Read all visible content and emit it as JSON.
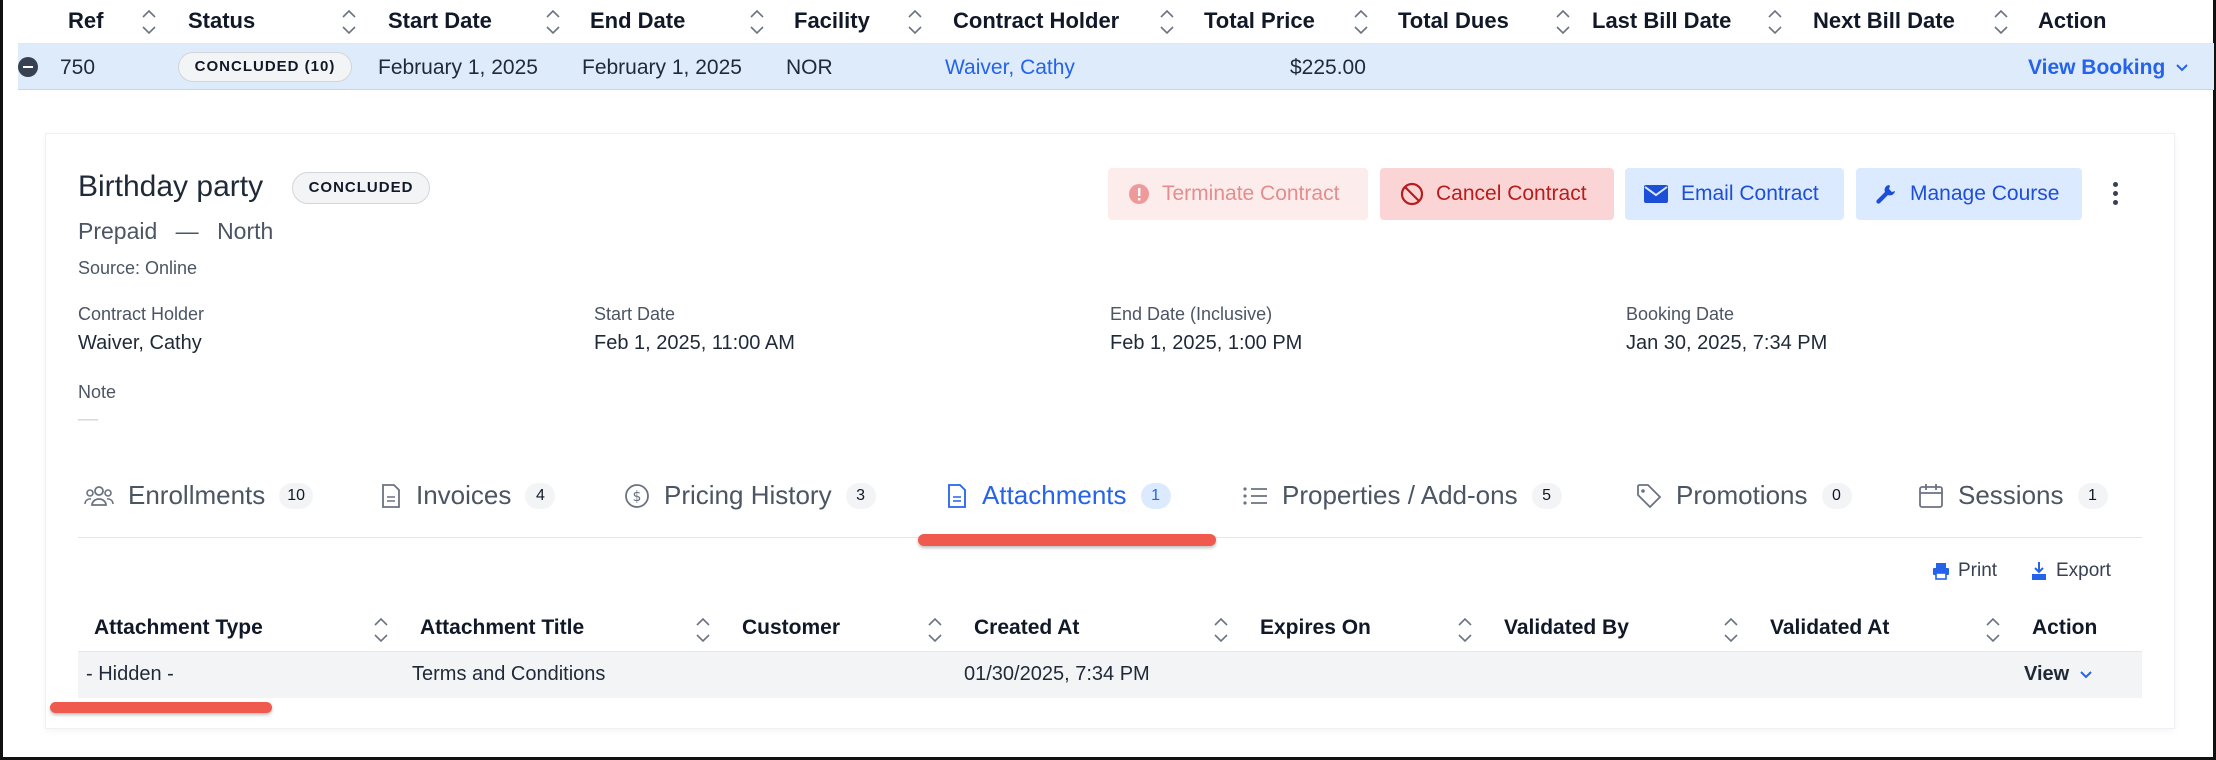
{
  "table": {
    "columns": [
      "Ref",
      "Status",
      "Start Date",
      "End Date",
      "Facility",
      "Contract Holder",
      "Total Price",
      "Total Dues",
      "Last Bill Date",
      "Next Bill Date",
      "Action"
    ],
    "row": {
      "ref": "750",
      "status": "CONCLUDED (10)",
      "start_date": "February 1, 2025",
      "end_date": "February 1, 2025",
      "facility": "NOR",
      "contract_holder": "Waiver, Cathy",
      "total_price": "$225.00",
      "action": "View Booking"
    }
  },
  "detail": {
    "title": "Birthday party",
    "status_badge": "CONCLUDED",
    "plan": "Prepaid",
    "separator": "—",
    "region": "North",
    "source": "Source: Online",
    "buttons": {
      "terminate": "Terminate Contract",
      "cancel": "Cancel Contract",
      "email": "Email Contract",
      "manage": "Manage Course"
    },
    "fields": {
      "contract_holder_label": "Contract Holder",
      "contract_holder_value": "Waiver, Cathy",
      "start_label": "Start Date",
      "start_value": "Feb 1, 2025, 11:00 AM",
      "end_label": "End Date (Inclusive)",
      "end_value": "Feb 1, 2025, 1:00 PM",
      "booking_label": "Booking Date",
      "booking_value": "Jan 30, 2025, 7:34 PM",
      "note_label": "Note",
      "note_value": "—"
    }
  },
  "tabs": [
    {
      "label": "Enrollments",
      "count": "10",
      "icon": "users-icon"
    },
    {
      "label": "Invoices",
      "count": "4",
      "icon": "document-icon"
    },
    {
      "label": "Pricing History",
      "count": "3",
      "icon": "dollar-icon"
    },
    {
      "label": "Attachments",
      "count": "1",
      "icon": "file-icon",
      "active": true
    },
    {
      "label": "Properties / Add-ons",
      "count": "5",
      "icon": "list-icon"
    },
    {
      "label": "Promotions",
      "count": "0",
      "icon": "tag-icon"
    },
    {
      "label": "Sessions",
      "count": "1",
      "icon": "calendar-icon"
    }
  ],
  "toolbar": {
    "print": "Print",
    "export": "Export"
  },
  "attachments": {
    "columns": [
      "Attachment Type",
      "Attachment Title",
      "Customer",
      "Created At",
      "Expires On",
      "Validated By",
      "Validated At",
      "Action"
    ],
    "rows": [
      {
        "type": "- Hidden -",
        "title": "Terms and Conditions",
        "customer": "",
        "created_at": "01/30/2025, 7:34 PM",
        "action": "View"
      }
    ]
  },
  "colors": {
    "accent": "#2563eb",
    "danger": "#b91c1c",
    "highlight": "#f05a4e",
    "row_selected": "#deebfb"
  }
}
